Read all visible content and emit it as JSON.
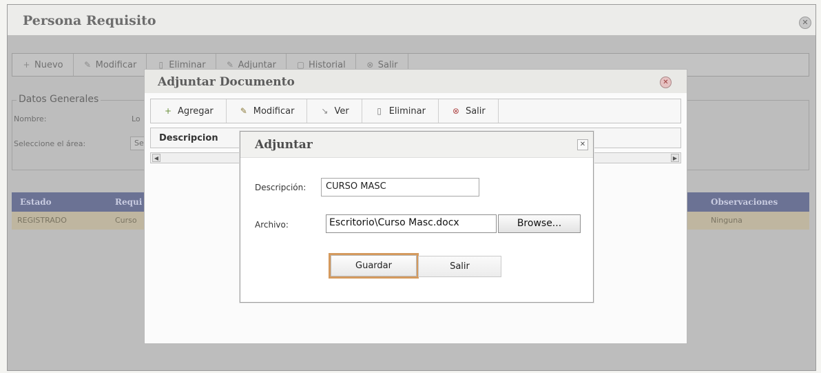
{
  "outer_window": {
    "title": "Persona Requisito",
    "toolbar": [
      {
        "label": "Nuevo",
        "icon": "new-icon"
      },
      {
        "label": "Modificar",
        "icon": "edit-icon"
      },
      {
        "label": "Eliminar",
        "icon": "delete-icon"
      },
      {
        "label": "Adjuntar",
        "icon": "attach-icon"
      },
      {
        "label": "Historial",
        "icon": "history-icon"
      },
      {
        "label": "Salir",
        "icon": "exit-icon"
      }
    ],
    "group_title": "Datos Generales",
    "fields": {
      "nombre_label": "Nombre:",
      "nombre_value": "Lo",
      "area_label": "Seleccione el área:",
      "area_value": "Se"
    },
    "grid": {
      "headers": [
        "Estado",
        "Requi",
        "Observaciones"
      ],
      "rows": [
        {
          "estado": "REGISTRADO",
          "requisito": "Curso",
          "observaciones": "Ninguna"
        }
      ]
    }
  },
  "adjuntar_documento": {
    "title": "Adjuntar Documento",
    "toolbar": [
      {
        "label": "Agregar",
        "icon": "add-icon"
      },
      {
        "label": "Modificar",
        "icon": "edit-icon"
      },
      {
        "label": "Ver",
        "icon": "view-icon"
      },
      {
        "label": "Eliminar",
        "icon": "delete-icon"
      },
      {
        "label": "Salir",
        "icon": "exit-icon"
      }
    ],
    "grid_header": "Descripcion"
  },
  "adjuntar": {
    "title": "Adjuntar",
    "descripcion_label": "Descripción:",
    "descripcion_value": "CURSO MASC",
    "archivo_label": "Archivo:",
    "archivo_value": "Escritorio\\Curso Masc.docx",
    "browse_label": "Browse...",
    "guardar_label": "Guardar",
    "salir_label": "Salir"
  }
}
